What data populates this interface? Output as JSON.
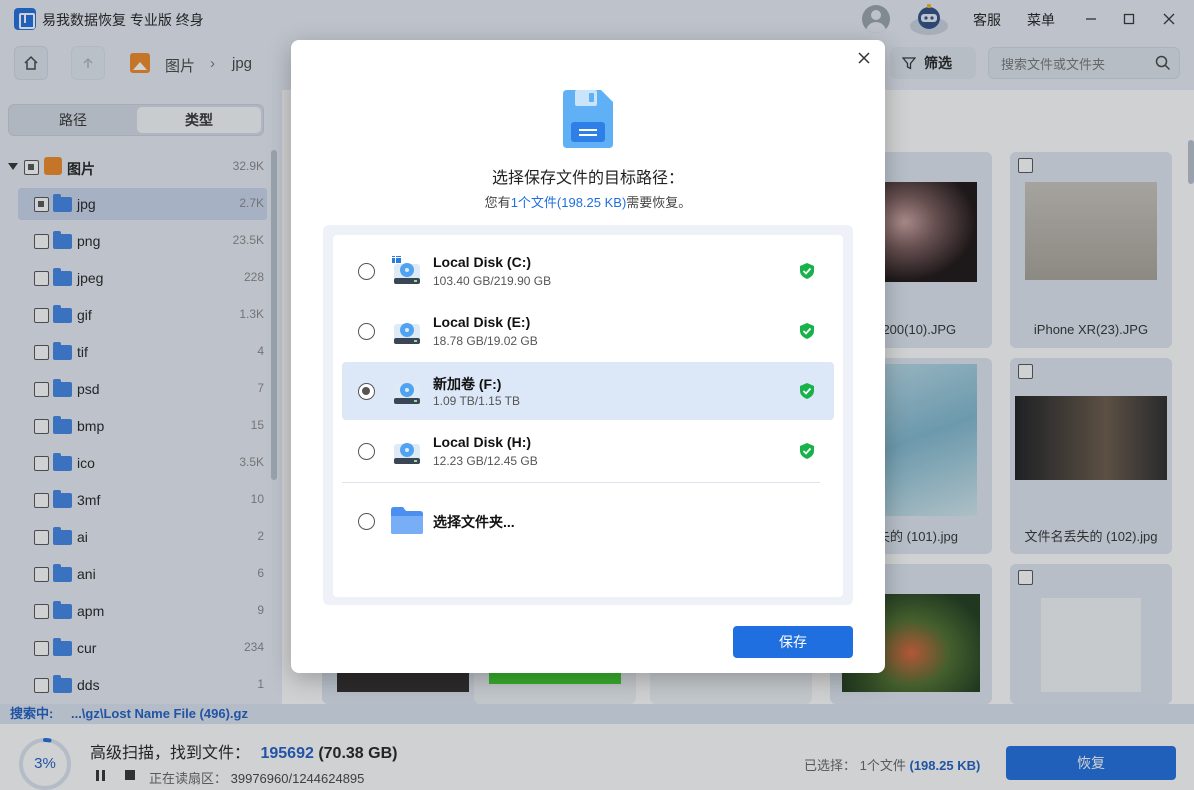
{
  "app": {
    "title": "易我数据恢复 专业版 终身",
    "service_label": "客服",
    "menu_label": "菜单"
  },
  "toolbar": {
    "breadcrumb": [
      "图片",
      "jpg"
    ],
    "filter_label": "筛选",
    "search_placeholder": "搜索文件或文件夹"
  },
  "sidebar": {
    "tabs": [
      {
        "label": "路径",
        "active": false
      },
      {
        "label": "类型",
        "active": true
      }
    ],
    "root": {
      "label": "图片",
      "count": "32.9K"
    },
    "items": [
      {
        "label": "jpg",
        "count": "2.7K",
        "selected": true
      },
      {
        "label": "png",
        "count": "23.5K"
      },
      {
        "label": "jpeg",
        "count": "228"
      },
      {
        "label": "gif",
        "count": "1.3K"
      },
      {
        "label": "tif",
        "count": "4"
      },
      {
        "label": "psd",
        "count": "7"
      },
      {
        "label": "bmp",
        "count": "15"
      },
      {
        "label": "ico",
        "count": "3.5K"
      },
      {
        "label": "3mf",
        "count": "10"
      },
      {
        "label": "ai",
        "count": "2"
      },
      {
        "label": "ani",
        "count": "6"
      },
      {
        "label": "apm",
        "count": "9"
      },
      {
        "label": "cur",
        "count": "234"
      },
      {
        "label": "dds",
        "count": "1"
      }
    ]
  },
  "gallery": {
    "items": [
      {
        "name": "D3200(10).JPG"
      },
      {
        "name": "iPhone XR(23).JPG"
      },
      {
        "name": "丢失的 (101).jpg"
      },
      {
        "name": "文件名丢失的 (102).jpg"
      }
    ]
  },
  "dialog": {
    "title": "选择保存文件的目标路径：",
    "subtitle_prefix": "您有",
    "subtitle_highlight": "1个文件(198.25 KB)",
    "subtitle_suffix": "需要恢复。",
    "drives": [
      {
        "name": "Local Disk (C:)",
        "size": "103.40 GB/219.90 GB",
        "selected": false
      },
      {
        "name": "Local Disk (E:)",
        "size": "18.78 GB/19.02 GB",
        "selected": false
      },
      {
        "name": "新加卷 (F:)",
        "size": "1.09 TB/1.15 TB",
        "selected": true
      },
      {
        "name": "Local Disk (H:)",
        "size": "12.23 GB/12.45 GB",
        "selected": false
      }
    ],
    "choose_folder_label": "选择文件夹...",
    "save_label": "保存"
  },
  "status": {
    "searching_label": "搜索中:",
    "searching_path": "...\\gz\\Lost Name File (496).gz",
    "progress_percent": "3%",
    "progress_value": 0.03,
    "scan_label": "高级扫描，找到文件：",
    "found_count": "195692",
    "found_size": "(70.38 GB)",
    "sector_label": "正在读扇区：",
    "sector_value": "39976960/1244624895",
    "selected_label": "已选择：",
    "selected_count": "1个文件",
    "selected_size": "(198.25 KB)",
    "recover_label": "恢复"
  },
  "colors": {
    "accent": "#1f6fe0",
    "panel_bg": "#e8eef6",
    "safe_green": "#18b24b"
  }
}
